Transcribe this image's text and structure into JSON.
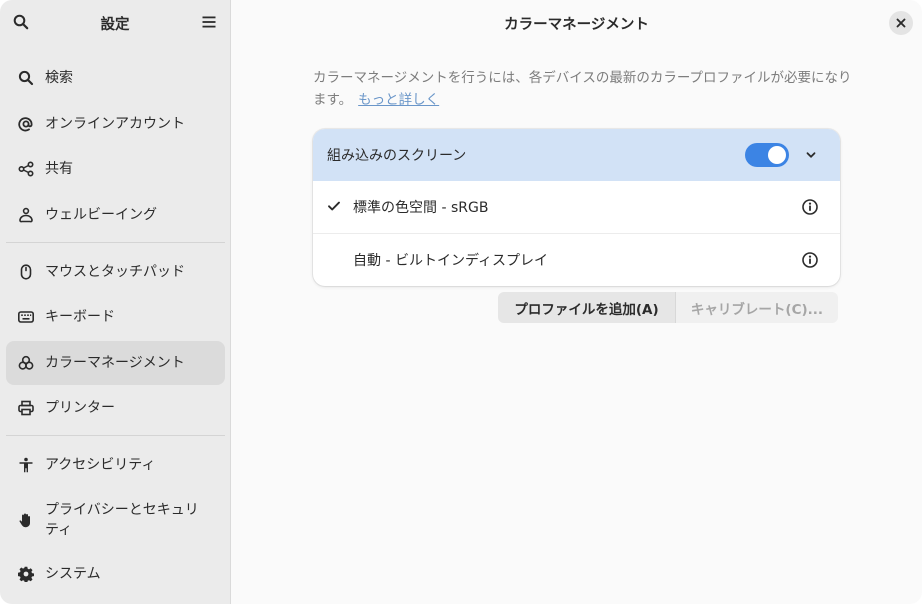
{
  "sidebar": {
    "title": "設定",
    "items": [
      {
        "label": "検索",
        "icon": "search-icon"
      },
      {
        "label": "オンラインアカウント",
        "icon": "at-sign-icon"
      },
      {
        "label": "共有",
        "icon": "share-icon"
      },
      {
        "label": "ウェルビーイング",
        "icon": "wellbeing-icon"
      },
      {
        "label": "マウスとタッチパッド",
        "icon": "mouse-icon"
      },
      {
        "label": "キーボード",
        "icon": "keyboard-icon"
      },
      {
        "label": "カラーマネージメント",
        "icon": "color-icon",
        "active": true
      },
      {
        "label": "プリンター",
        "icon": "printer-icon"
      },
      {
        "label": "アクセシビリティ",
        "icon": "accessibility-icon"
      },
      {
        "label": "プライバシーとセキュリティ",
        "icon": "hand-icon"
      },
      {
        "label": "システム",
        "icon": "gear-icon"
      }
    ]
  },
  "main": {
    "title": "カラーマネージメント",
    "description": "カラーマネージメントを行うには、各デバイスの最新のカラープロファイルが必要になります。",
    "learn_more": "もっと詳しく",
    "device": {
      "name": "組み込みのスクリーン",
      "enabled": true,
      "profiles": [
        {
          "label": "標準の色空間 - sRGB",
          "selected": true
        },
        {
          "label": "自動 - ビルトインディスプレイ",
          "selected": false
        }
      ]
    },
    "buttons": {
      "add_profile": "プロファイルを追加(A)",
      "calibrate": "キャリブレート(C)..."
    }
  },
  "colors": {
    "accent": "#3c84e4",
    "row_highlight": "#d2e2f6",
    "sidebar_bg": "#ebebeb",
    "link": "#6a96c9"
  }
}
